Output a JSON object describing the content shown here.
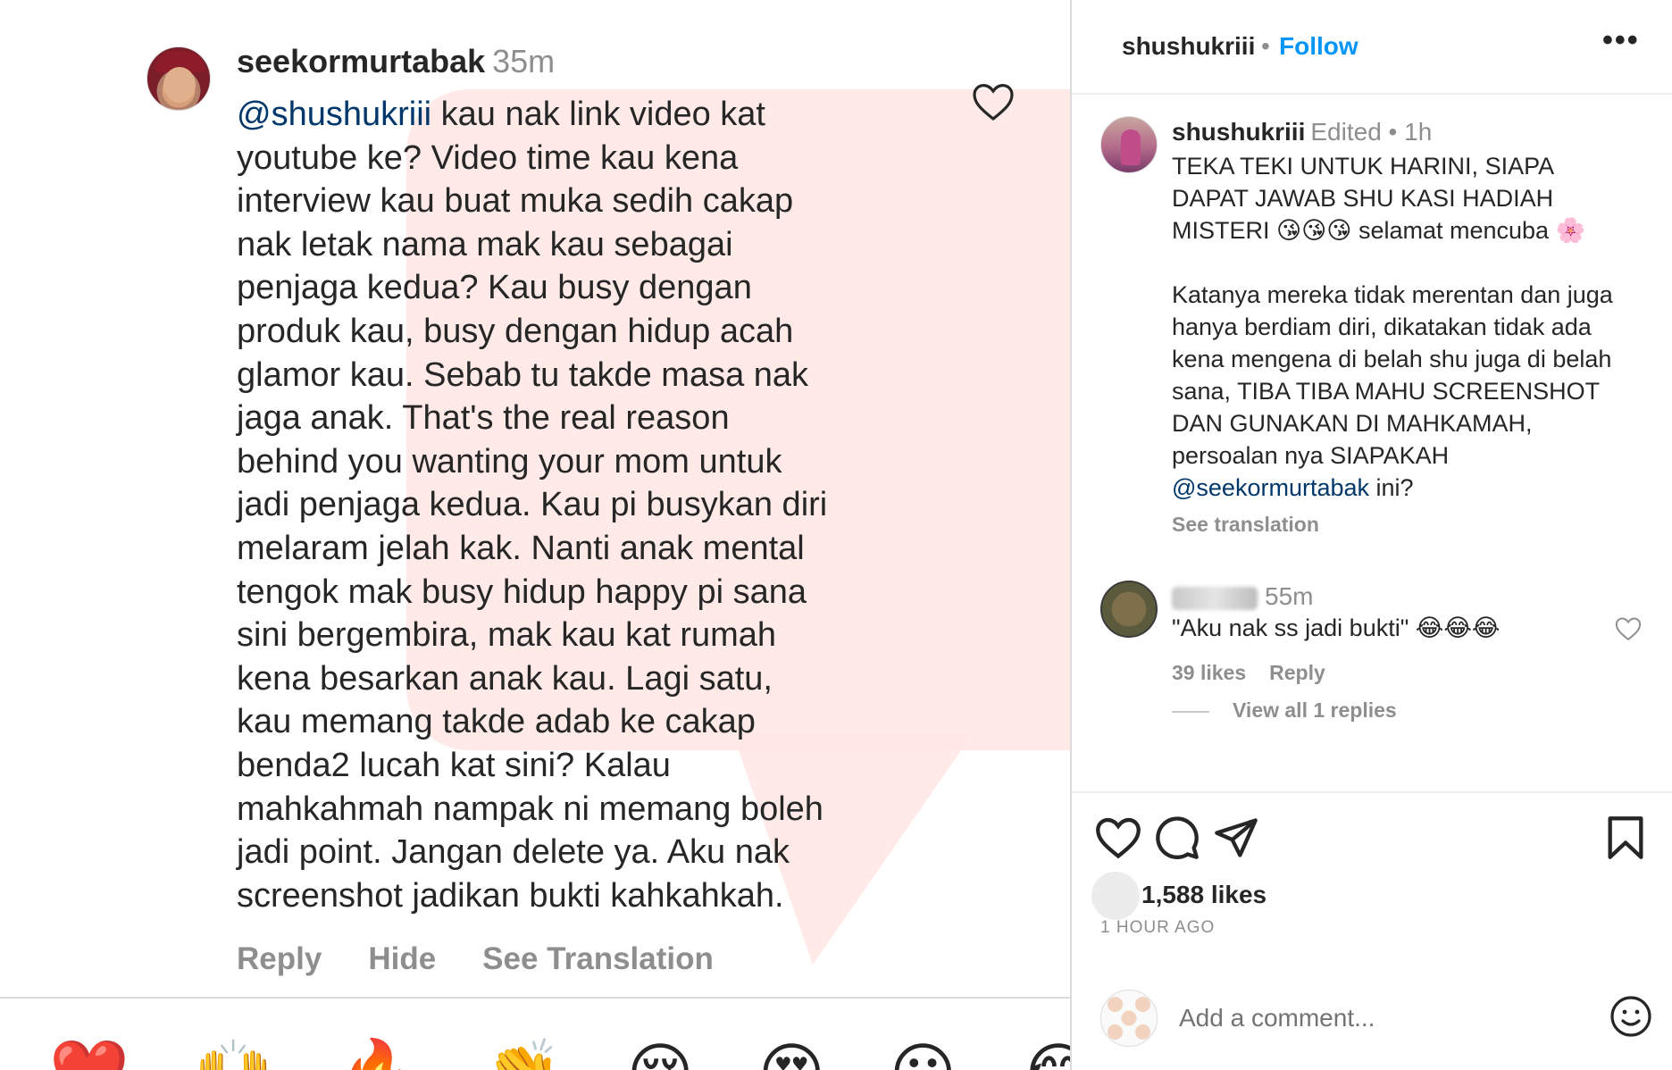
{
  "comment": {
    "username": "seekormurtabak",
    "time": "35m",
    "mention": "@shushukriii",
    "lines": [
      " kau nak link video kat",
      "youtube ke? Video time kau kena",
      "interview kau buat muka sedih cakap",
      "nak letak nama mak kau sebagai",
      "penjaga kedua? Kau busy dengan",
      "produk kau, busy dengan hidup acah",
      "glamor kau. Sebab tu takde masa nak",
      "jaga anak. That's the real reason",
      "behind you wanting your mom untuk",
      "jadi penjaga kedua. Kau pi busykan diri",
      "melaram jelah kak. Nanti anak mental",
      "tengok mak busy hidup happy pi sana",
      "sini bergembira, mak kau kat rumah",
      "kena besarkan anak kau. Lagi satu,",
      "kau memang takde adab ke cakap",
      "benda2 lucah kat sini? Kalau",
      "mahkahmah nampak ni memang boleh",
      "jadi point. Jangan delete ya. Aku nak",
      "screenshot jadikan bukti kahkahkah."
    ],
    "actions": {
      "reply": "Reply",
      "hide": "Hide",
      "see_translation": "See Translation"
    },
    "reactions": [
      "❤️",
      "🙌",
      "🔥",
      "👏",
      "😢",
      "😍",
      "😮",
      "😂"
    ],
    "icons": {
      "like": "heart-icon"
    }
  },
  "post": {
    "header": {
      "username": "shushukriii",
      "separator": "•",
      "follow": "Follow",
      "more": "•••"
    },
    "caption": {
      "username": "shushukriii",
      "edited": "Edited •  1h",
      "lines_1": [
        "TEKA TEKI UNTUK HARINI, SIAPA",
        "DAPAT JAWAB SHU KASI HADIAH",
        "MISTERI 😘😘😘 selamat mencuba 🌸"
      ],
      "lines_2": [
        "Katanya mereka tidak merentan dan juga",
        "hanya berdiam diri, dikatakan tidak ada",
        "kena mengena di belah shu juga di belah",
        "sana, TIBA TIBA MAHU SCREENSHOT",
        "DAN GUNAKAN DI MAHKAMAH,",
        "persoalan nya SIAPAKAH"
      ],
      "mention": "@seekormurtabak",
      "after_mention": " ini?",
      "see_translation": "See translation"
    },
    "comment": {
      "time": "55m",
      "text": "\"Aku nak ss jadi bukti\" 😂😂😂",
      "likes": "39 likes",
      "reply": "Reply",
      "view_replies": "View all 1 replies"
    },
    "likes": "1,588 likes",
    "time_ago": "1 HOUR AGO",
    "add_comment_placeholder": "Add a comment...",
    "icons": {
      "like": "heart-icon",
      "comment": "comment-icon",
      "share": "share-icon",
      "save": "bookmark-icon",
      "emoji": "emoji-icon"
    }
  },
  "colors": {
    "link": "#00376b",
    "follow": "#0095f6",
    "muted": "#8e8e8e",
    "text": "#262626"
  }
}
